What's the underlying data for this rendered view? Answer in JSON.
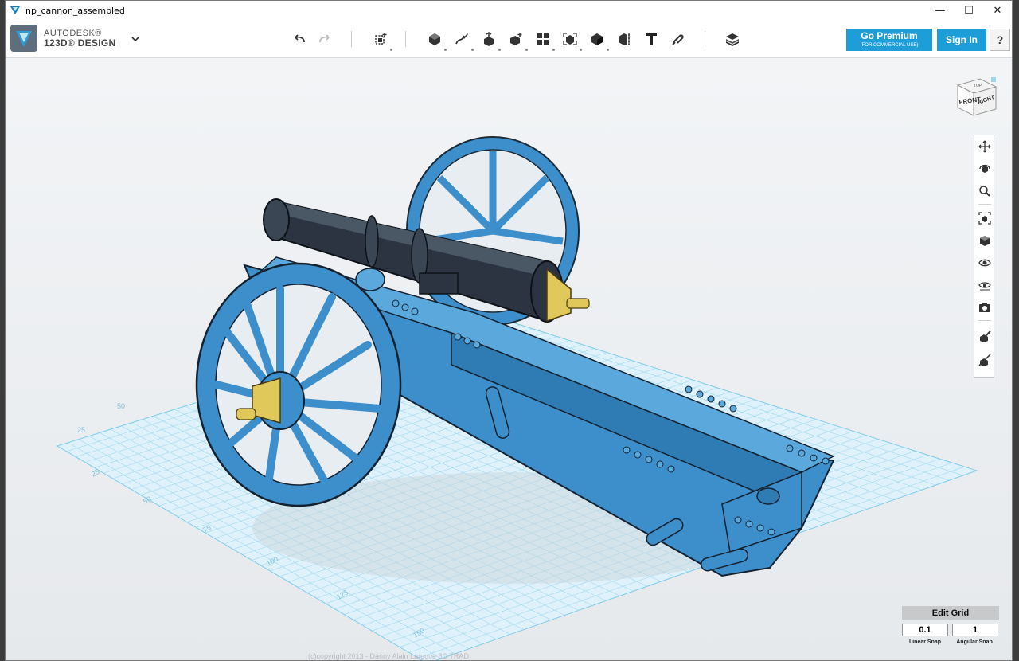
{
  "window": {
    "title": "np_cannon_assembled",
    "controls": [
      "—",
      "☐",
      "✕"
    ]
  },
  "app": {
    "brand_line1": "AUTODESK®",
    "brand_line2": "123D® DESIGN"
  },
  "toolbar": {
    "tools": [
      "undo-icon",
      "redo-icon",
      "primitives-icon",
      "sketch-icon",
      "construct-icon",
      "modify-icon",
      "pattern-icon",
      "group-icon",
      "combine-icon",
      "measure-icon",
      "text-icon",
      "snap-icon",
      "material-icon"
    ]
  },
  "account": {
    "premium_label": "Go Premium",
    "premium_sub": "(FOR COMMERCIAL USE)",
    "signin_label": "Sign In",
    "help_label": "?"
  },
  "viewcube": {
    "front": "FRONT",
    "right": "RIGHT",
    "top": "TOP"
  },
  "navbar": {
    "items": [
      "pan-icon",
      "orbit-icon",
      "zoom-icon",
      "fit-icon",
      "views-icon",
      "visibility-icon",
      "material-view-icon",
      "camera-icon",
      "snap-view-icon",
      "hide-icon"
    ]
  },
  "grid_ticks": [
    "25",
    "50",
    "75",
    "100",
    "125",
    "150",
    "25",
    "50"
  ],
  "edit_grid": {
    "label": "Edit Grid",
    "linear_value": "0.1",
    "angular_value": "1",
    "linear_label": "Linear Snap",
    "angular_label": "Angular Snap"
  },
  "footer": {
    "text": "(c)copyright 2013 - Danny Alain Laroque 3D TRAD"
  },
  "colors": {
    "accent": "#1e9ed8",
    "model_blue": "#3d8fcc",
    "barrel": "#2b3440",
    "brass": "#e0c85a",
    "grid": "#8fd3ef"
  }
}
